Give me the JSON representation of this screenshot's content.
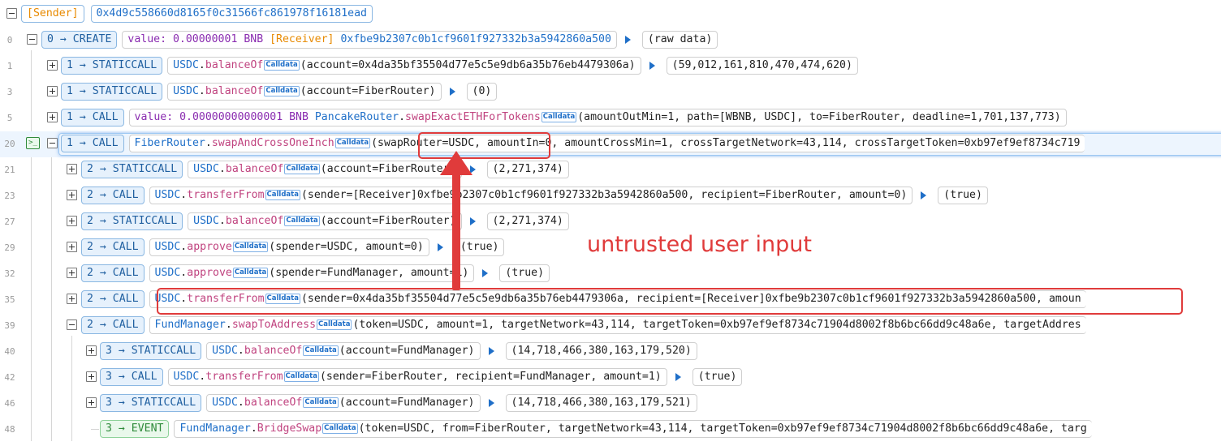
{
  "root": {
    "sender_label": "[Sender]",
    "sender_address": "0x4d9c558660d8165f0c31566fc861978f16181ead"
  },
  "rows": [
    {
      "line": "0",
      "op": "0 → CREATE",
      "text1": "value: 0.00000001 BNB",
      "text2": "[Receiver]",
      "text3": "0xfbe9b2307c0b1cf9601f927332b3a5942860a500",
      "result": "(raw data)"
    },
    {
      "line": "1",
      "op": "1 → STATICCALL",
      "contract": "USDC",
      "method": "balanceOf",
      "badge": "Calldata",
      "args": "(account=0x4da35bf35504d77e5c5e9db6a35b76eb4479306a)",
      "result": "(59,012,161,810,470,474,620)"
    },
    {
      "line": "3",
      "op": "1 → STATICCALL",
      "contract": "USDC",
      "method": "balanceOf",
      "badge": "Calldata",
      "args": "(account=FiberRouter)",
      "result": "(0)"
    },
    {
      "line": "5",
      "op": "1 → CALL",
      "value": "value: 0.00000000000001 BNB",
      "contract": "PancakeRouter",
      "method": "swapExactETHForTokens",
      "badge": "Calldata",
      "args": "(amountOutMin=1, path=[WBNB, USDC], to=FiberRouter, deadline=1,701,137,773)"
    },
    {
      "line": "20",
      "op": "1 → CALL",
      "contract": "FiberRouter",
      "method": "swapAndCrossOneInch",
      "badge": "Calldata",
      "args": "(swapRouter=USDC, amountIn=0, amountCrossMin=1, crossTargetNetwork=43,114, crossTargetToken=0xb97ef9ef8734c719"
    },
    {
      "line": "21",
      "op": "2 → STATICCALL",
      "contract": "USDC",
      "method": "balanceOf",
      "badge": "Calldata",
      "args": "(account=FiberRouter)",
      "result": "(2,271,374)"
    },
    {
      "line": "23",
      "op": "2 → CALL",
      "contract": "USDC",
      "method": "transferFrom",
      "badge": "Calldata",
      "args": "(sender=[Receiver]0xfbe9b2307c0b1cf9601f927332b3a5942860a500, recipient=FiberRouter, amount=0)",
      "result": "(true)"
    },
    {
      "line": "27",
      "op": "2 → STATICCALL",
      "contract": "USDC",
      "method": "balanceOf",
      "badge": "Calldata",
      "args": "(account=FiberRouter)",
      "result": "(2,271,374)"
    },
    {
      "line": "29",
      "op": "2 → CALL",
      "contract": "USDC",
      "method": "approve",
      "badge": "Calldata",
      "args": "(spender=USDC, amount=0)",
      "result": "(true)"
    },
    {
      "line": "32",
      "op": "2 → CALL",
      "contract": "USDC",
      "method": "approve",
      "badge": "Calldata",
      "args": "(spender=FundManager, amount=1)",
      "result": "(true)"
    },
    {
      "line": "35",
      "op": "2 → CALL",
      "contract": "USDC",
      "method": "transferFrom",
      "badge": "Calldata",
      "args": "(sender=0x4da35bf35504d77e5c5e9db6a35b76eb4479306a, recipient=[Receiver]0xfbe9b2307c0b1cf9601f927332b3a5942860a500, amoun"
    },
    {
      "line": "39",
      "op": "2 → CALL",
      "contract": "FundManager",
      "method": "swapToAddress",
      "badge": "Calldata",
      "args": "(token=USDC, amount=1, targetNetwork=43,114, targetToken=0xb97ef9ef8734c71904d8002f8b6bc66dd9c48a6e, targetAddres"
    },
    {
      "line": "40",
      "op": "3 → STATICCALL",
      "contract": "USDC",
      "method": "balanceOf",
      "badge": "Calldata",
      "args": "(account=FundManager)",
      "result": "(14,718,466,380,163,179,520)"
    },
    {
      "line": "42",
      "op": "3 → CALL",
      "contract": "USDC",
      "method": "transferFrom",
      "badge": "Calldata",
      "args": "(sender=FiberRouter, recipient=FundManager, amount=1)",
      "result": "(true)"
    },
    {
      "line": "46",
      "op": "3 → STATICCALL",
      "contract": "USDC",
      "method": "balanceOf",
      "badge": "Calldata",
      "args": "(account=FundManager)",
      "result": "(14,718,466,380,163,179,521)"
    },
    {
      "line": "48",
      "op": "3 → EVENT",
      "contract": "FundManager",
      "method": "BridgeSwap",
      "badge": "Calldata",
      "args": "(token=USDC, from=FiberRouter, targetNetwork=43,114, targetToken=0xb97ef9ef8734c71904d8002f8b6bc66dd9c48a6e, targ"
    }
  ],
  "annotation": "untrusted user input",
  "colors": {
    "highlight": "#e03b3b",
    "op_blue": "#1f5fa0",
    "address_blue": "#1f6fc8",
    "method_pink": "#c0437f",
    "receiver_orange": "#e88a00",
    "value_purple": "#8a2cb0",
    "event_green": "#2f8b3b"
  }
}
